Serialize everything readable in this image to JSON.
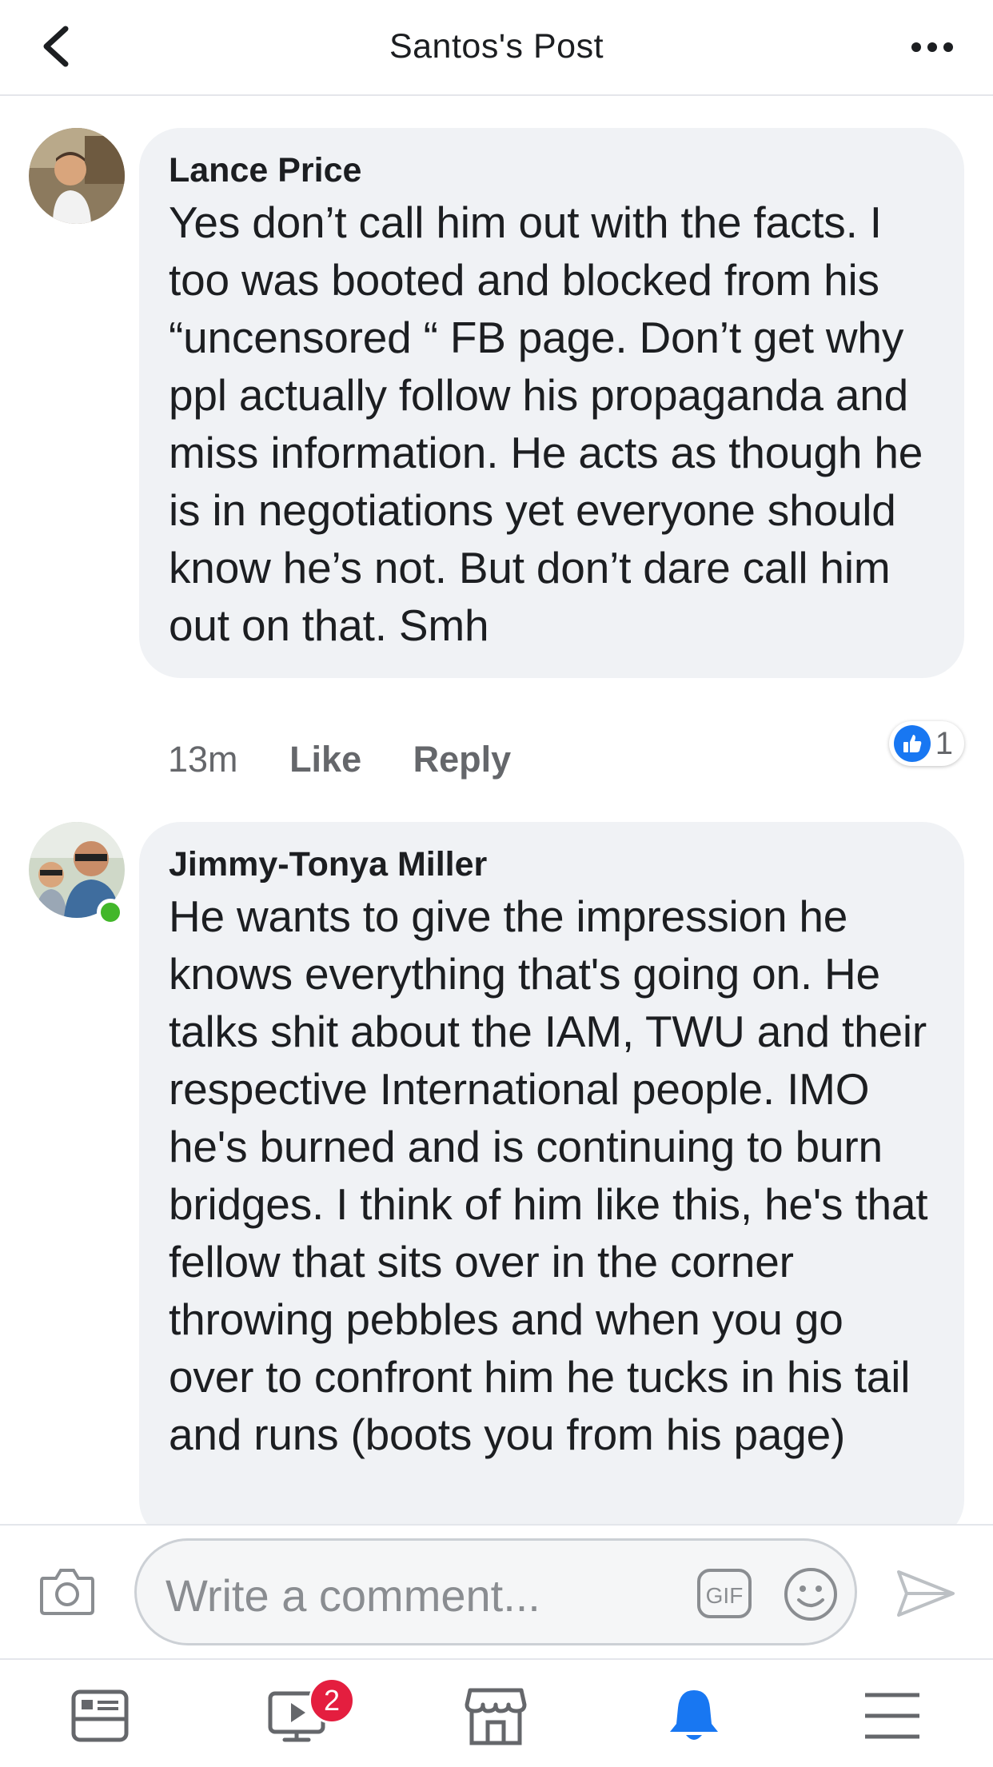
{
  "header": {
    "title": "Santos's Post"
  },
  "comments": [
    {
      "author": "Lance Price",
      "text": "Yes don’t call him out with the facts. I too was booted and blocked from his “uncensored “ FB page. Don’t get why ppl actually follow his propaganda and miss information. He acts as though he is in negotiations yet everyone should know he’s not. But don’t dare call him out on that. Smh",
      "time": "13m",
      "like_label": "Like",
      "reply_label": "Reply",
      "reaction_count": "1"
    },
    {
      "author": "Jimmy-Tonya Miller",
      "text": "He wants to give the impression he knows everything that's going on. He talks shit about the IAM, TWU and their respective International people.  IMO he's burned and is continuing to burn bridges. I think of him like this,  he's that fellow that sits over in the corner throwing pebbles and when you go over to confront him he tucks in his tail and runs (boots you from his page)"
    }
  ],
  "composer": {
    "placeholder": "Write a comment...",
    "gif_label": "GIF"
  },
  "tabbar": {
    "video_badge": "2"
  },
  "colors": {
    "accent": "#1877f2",
    "bubble": "#f0f2f5",
    "badge": "#e41e3f",
    "online": "#42b72a"
  }
}
